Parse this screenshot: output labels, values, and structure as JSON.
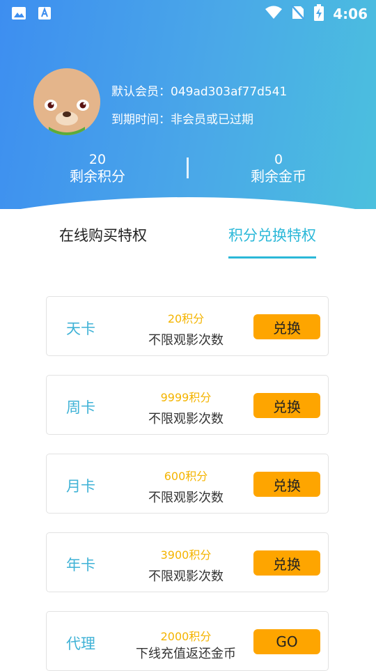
{
  "status_bar": {
    "time": "4:06"
  },
  "member": {
    "id_label": "默认会员：",
    "id_value": "049ad303af77d541",
    "expire_label": "到期时间：",
    "expire_value": "非会员或已过期"
  },
  "stats": [
    {
      "value": "20",
      "label": "剩余积分"
    },
    {
      "value": "0",
      "label": "剩余金币"
    }
  ],
  "tabs": [
    {
      "label": "在线购买特权",
      "active": false
    },
    {
      "label": "积分兑换特权",
      "active": true
    }
  ],
  "cards": [
    {
      "name": "天卡",
      "points": "20积分",
      "desc": "不限观影次数",
      "button": "兑换"
    },
    {
      "name": "周卡",
      "points": "9999积分",
      "desc": "不限观影次数",
      "button": "兑换"
    },
    {
      "name": "月卡",
      "points": "600积分",
      "desc": "不限观影次数",
      "button": "兑换"
    },
    {
      "name": "年卡",
      "points": "3900积分",
      "desc": "不限观影次数",
      "button": "兑换"
    },
    {
      "name": "代理",
      "points": "2000积分",
      "desc": "下线充值返还金币",
      "button": "GO"
    }
  ],
  "colors": {
    "header_start": "#3d8ef0",
    "header_end": "#4bc0de",
    "accent": "#2bb8d8",
    "button": "#fea500",
    "points": "#f4b400"
  }
}
